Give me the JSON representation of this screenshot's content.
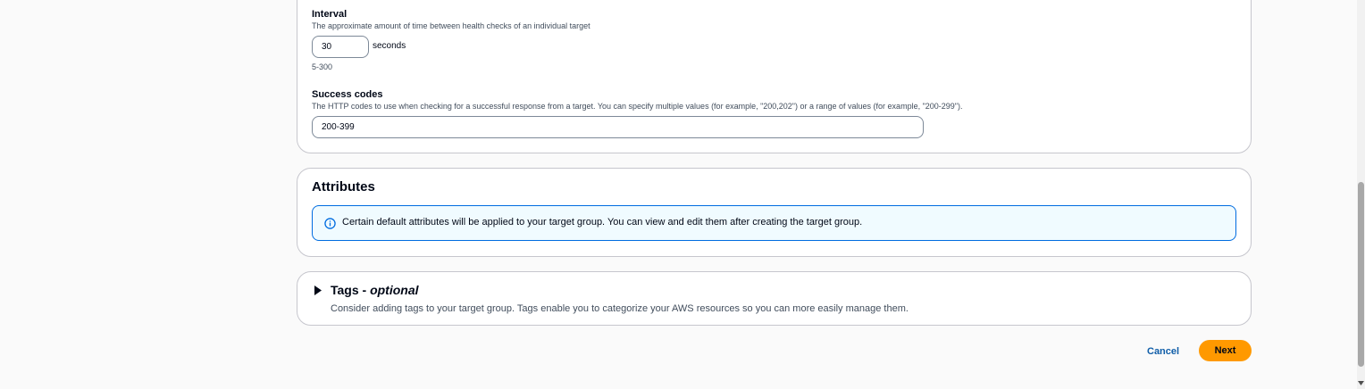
{
  "health_checks": {
    "interval": {
      "label": "Interval",
      "description": "The approximate amount of time between health checks of an individual target",
      "value": "30",
      "unit": "seconds",
      "constraint": "5-300"
    },
    "success_codes": {
      "label": "Success codes",
      "description": "The HTTP codes to use when checking for a successful response from a target. You can specify multiple values (for example, \"200,202\") or a range of values (for example, \"200-299\").",
      "value": "200-399"
    }
  },
  "attributes": {
    "title": "Attributes",
    "info_text": "Certain default attributes will be applied to your target group. You can view and edit them after creating the target group.",
    "info_icon": "info-icon"
  },
  "tags": {
    "title_main": "Tags - ",
    "title_optional": "optional",
    "description": "Consider adding tags to your target group. Tags enable you to categorize your AWS resources so you can more easily manage them.",
    "expand_icon": "caret-right-icon"
  },
  "actions": {
    "cancel_label": "Cancel",
    "next_label": "Next"
  },
  "colors": {
    "primary_button": "#ff9900",
    "link": "#0f5da8",
    "info_border": "#006ce0",
    "info_background": "#f0fbff"
  }
}
